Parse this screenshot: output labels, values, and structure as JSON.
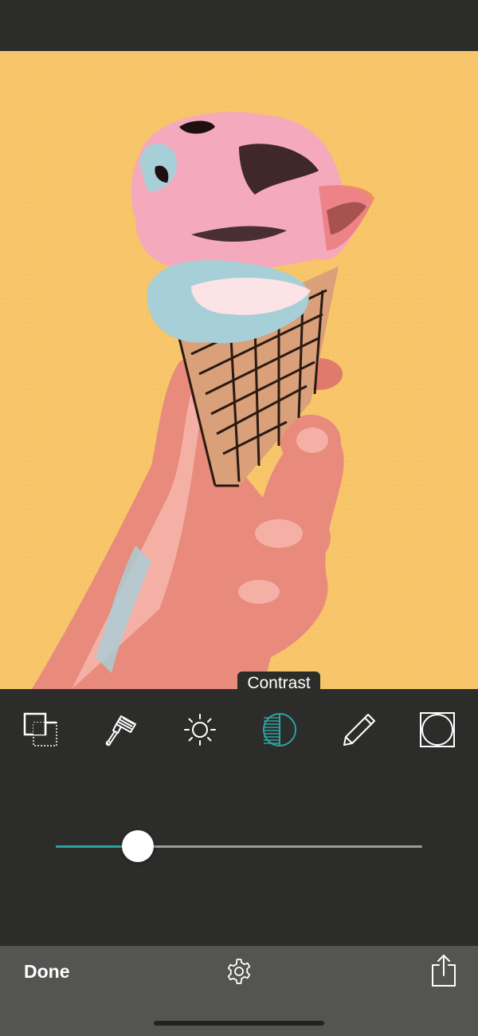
{
  "editor": {
    "active_tool_tooltip": "Contrast",
    "active_tool": "contrast",
    "accent_color": "#2aa3a0"
  },
  "photo": {
    "subject": "hand-holding-ice-cream-cone",
    "style": "posterized comic filter"
  },
  "toolbar": {
    "tools": [
      {
        "icon": "crop-layers-icon",
        "id": "crop"
      },
      {
        "icon": "paint-brush-icon",
        "id": "brush"
      },
      {
        "icon": "brightness-sun-icon",
        "id": "brightness"
      },
      {
        "icon": "contrast-icon",
        "id": "contrast",
        "active": true
      },
      {
        "icon": "pencil-icon",
        "id": "edges"
      },
      {
        "icon": "vignette-frame-icon",
        "id": "frame"
      }
    ]
  },
  "slider": {
    "value": 0.22,
    "track_color": "#9c9c9a",
    "fill_color": "#2aa3a0"
  },
  "bottom_bar": {
    "done_label": "Done",
    "settings_icon": "gear-icon",
    "share_icon": "share-icon"
  }
}
